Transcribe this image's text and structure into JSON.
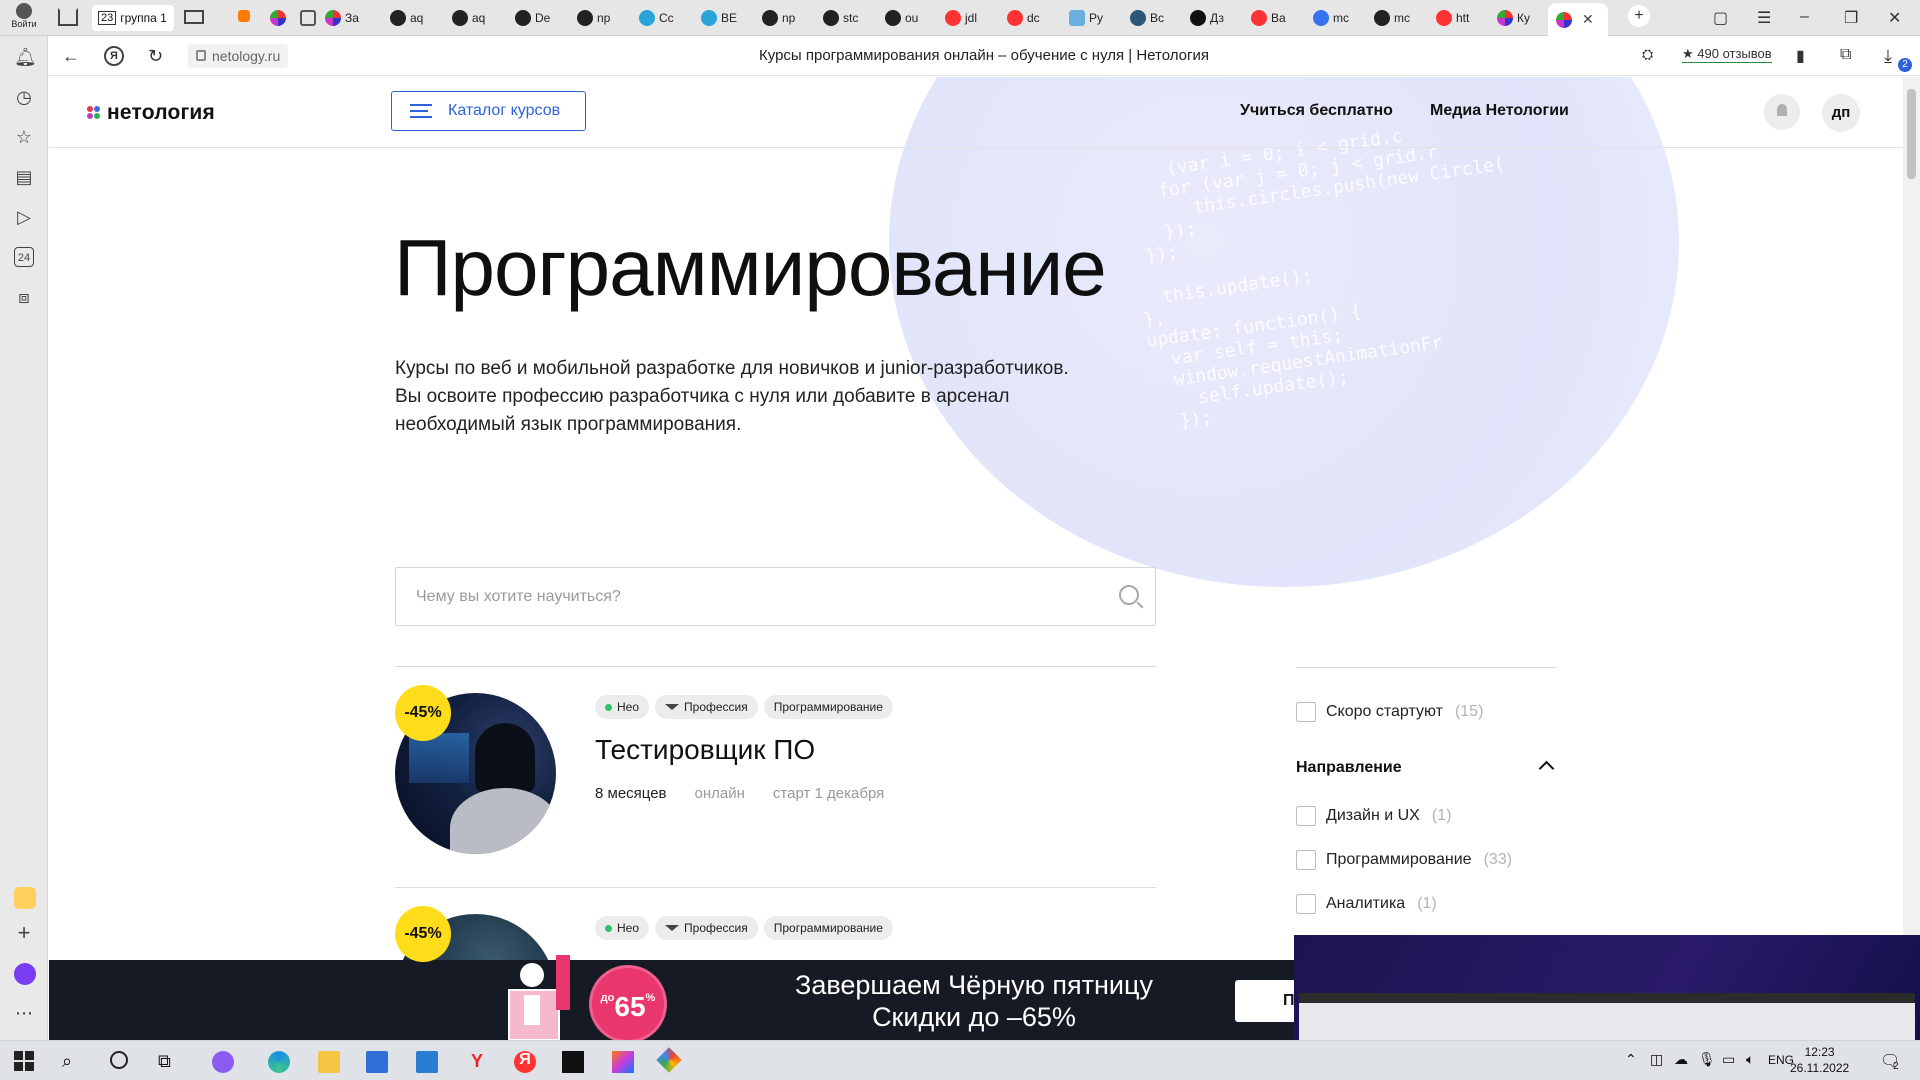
{
  "browser": {
    "tab_group_count": "23",
    "tab_group_label": "группа 1",
    "tabs": [
      {
        "label": "За",
        "icon": "netology-icon"
      },
      {
        "label": "aq",
        "icon": "github-icon"
      },
      {
        "label": "aq",
        "icon": "github-icon"
      },
      {
        "label": "De",
        "icon": "github-icon"
      },
      {
        "label": "np",
        "icon": "github-icon"
      },
      {
        "label": "Cc",
        "icon": "sync-icon"
      },
      {
        "label": "BE",
        "icon": "sync-icon"
      },
      {
        "label": "np",
        "icon": "github-icon"
      },
      {
        "label": "stc",
        "icon": "github-icon"
      },
      {
        "label": "ou",
        "icon": "github-icon"
      },
      {
        "label": "jdl",
        "icon": "yandex-icon"
      },
      {
        "label": "dc",
        "icon": "yandex-icon"
      },
      {
        "label": "Py",
        "icon": "puzzle-icon"
      },
      {
        "label": "Bc",
        "icon": "bird-icon"
      },
      {
        "label": "Дз",
        "icon": "plus-circle-icon"
      },
      {
        "label": "Ba",
        "icon": "yandex-icon"
      },
      {
        "label": "mc",
        "icon": "blue-circle-icon"
      },
      {
        "label": "mc",
        "icon": "github-icon"
      },
      {
        "label": "htt",
        "icon": "yandex-icon"
      },
      {
        "label": "Ку",
        "icon": "netology-icon"
      }
    ],
    "login_label": "Войти",
    "url": "netology.ru",
    "page_title": "Курсы программирования онлайн – обучение с нуля | Нетология",
    "reviews": "★ 490 отзывов",
    "downloads_badge": "2"
  },
  "site": {
    "logo": "нетология",
    "catalog_button": "Каталог курсов",
    "nav": [
      "Учиться бесплатно",
      "Медиа Нетологии"
    ],
    "avatar": "дп"
  },
  "hero": {
    "title": "Программирование",
    "description": "Курсы по веб и мобильной разработке для новичков и junior-разработчиков. Вы освоите профессию разработчика с нуля или добавите в арсенал необходимый язык программирования."
  },
  "search": {
    "placeholder": "Чему вы хотите научиться?"
  },
  "courses": [
    {
      "discount": "-45%",
      "tags": [
        "Нео",
        "Профессия",
        "Программирование"
      ],
      "title": "Тестировщик ПО",
      "duration": "8 месяцев",
      "format": "онлайн",
      "start": "старт 1 декабря"
    },
    {
      "discount": "-45%",
      "tags": [
        "Нео",
        "Профессия",
        "Программирование"
      ],
      "title": "",
      "duration": "",
      "format": "",
      "start": ""
    }
  ],
  "filters": {
    "soon": {
      "label": "Скоро стартуют",
      "count": "(15)"
    },
    "direction_heading": "Направление",
    "directions": [
      {
        "label": "Дизайн и UX",
        "count": "(1)"
      },
      {
        "label": "Программирование",
        "count": "(33)"
      },
      {
        "label": "Аналитика",
        "count": "(1)"
      }
    ]
  },
  "promo": {
    "badge_prefix": "до",
    "badge_value": "65",
    "badge_suffix": "%",
    "line1": "Завершаем Чёрную пятницу",
    "line2": "Скидки до –65%",
    "button": "П"
  },
  "taskbar": {
    "lang": "ENG",
    "time": "12:23",
    "date": "26.11.2022",
    "notif_count": "2"
  },
  "colors": {
    "brand_blue": "#2d62d9",
    "discount_yellow": "#ffdd1a",
    "promo_pink": "#e9366c",
    "promo_bg": "#151a24"
  }
}
